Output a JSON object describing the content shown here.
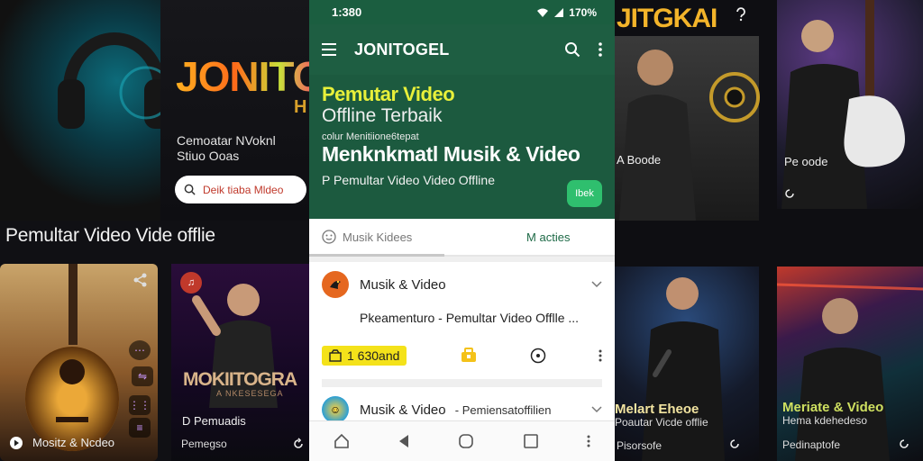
{
  "background_left": {
    "brand": "JONITO",
    "brand_tail": "H",
    "caption_line1": "Cemoatar NVoknl",
    "caption_line2": "Stiuo Ooas",
    "search_label": "Deik tiaba Mldeo",
    "heading": "Pemultar Video Vide offlie",
    "guitar_caption": "Mositz & Ncdeo",
    "poster_title": "MOKIITOGRA",
    "poster_subtitle": "A NKESESEGA",
    "poster_caption": "D Pemuadis",
    "poster_caption2": "Pemegso"
  },
  "background_right": {
    "brand": "JITGKAI",
    "man_caption": "A Boode",
    "guitar_caption": "Pe oode",
    "mic_caption1": "Melart Eheoe",
    "mic_caption2": "Poautar Vicde offlie",
    "mic_caption3": "Pisorsofe",
    "neon_caption1": "Meriate & Video",
    "neon_caption2": "Hema kdehedeso",
    "neon_caption3": "Pedinaptofe"
  },
  "phone": {
    "status": {
      "time": "1:380",
      "battery": "170%"
    },
    "appbar": {
      "title": "JONITOGEL"
    },
    "hero": {
      "title_line1": "Pemutar Video",
      "title_line2": "Offline Terbaik",
      "small": "colur Menitiione6tepat",
      "big": "Menknkmatl Musik & Video",
      "line": "P Pemultar Video Video Offline",
      "cta": "Ibek"
    },
    "tabs": [
      {
        "label": "Musik Kidees"
      },
      {
        "label": "M acties"
      }
    ],
    "cards": [
      {
        "name": "Musik & Video",
        "sub": "",
        "desc": "Pkeamenturo - Pemultar Video Offlle ...",
        "likes": "1 630and"
      },
      {
        "name": "Musik & Video",
        "sub": "- Pemiensatoffilien",
        "desc": ""
      }
    ]
  },
  "colors": {
    "primary": "#1e5e42",
    "accent_yellow": "#e8f03a",
    "cta_green": "#2fbf6e",
    "like_yellow": "#f4e21a"
  }
}
